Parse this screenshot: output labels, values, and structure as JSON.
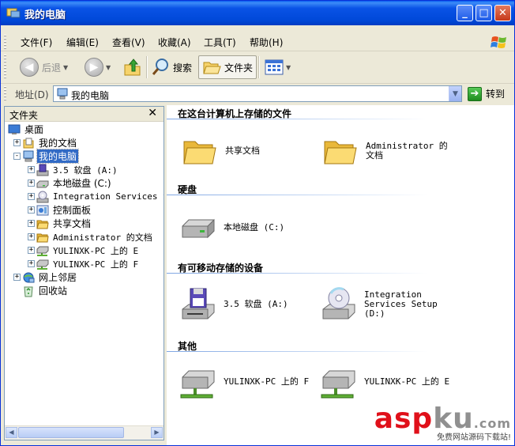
{
  "window": {
    "title": "我的电脑",
    "controls": [
      "_",
      "□",
      "✕"
    ]
  },
  "menubar": {
    "items": [
      "文件(F)",
      "编辑(E)",
      "查看(V)",
      "收藏(A)",
      "工具(T)",
      "帮助(H)"
    ]
  },
  "toolbar": {
    "back": "后退",
    "search": "搜索",
    "folders": "文件夹"
  },
  "address": {
    "label": "地址(D)",
    "value": "我的电脑",
    "go": "转到"
  },
  "folder_pane": {
    "title": "文件夹",
    "close": "✕",
    "tree": [
      {
        "label": "桌面",
        "level": 0,
        "expander": "",
        "icon": "desktop-icon"
      },
      {
        "label": "我的文档",
        "level": 1,
        "expander": "+",
        "icon": "my-documents-icon"
      },
      {
        "label": "我的电脑",
        "level": 1,
        "expander": "−",
        "icon": "my-computer-icon",
        "selected": true
      },
      {
        "label": "3.5 软盘 (A:)",
        "level": 2,
        "expander": "+",
        "icon": "floppy-icon"
      },
      {
        "label": "本地磁盘 (C:)",
        "level": 2,
        "expander": "+",
        "icon": "hard-disk-icon"
      },
      {
        "label": "Integration Services Se",
        "level": 2,
        "expander": "+",
        "icon": "cd-drive-icon"
      },
      {
        "label": "控制面板",
        "level": 2,
        "expander": "+",
        "icon": "control-panel-icon"
      },
      {
        "label": "共享文档",
        "level": 2,
        "expander": "+",
        "icon": "folder-icon"
      },
      {
        "label": "Administrator 的文档",
        "level": 2,
        "expander": "+",
        "icon": "folder-icon"
      },
      {
        "label": "YULINXK-PC 上的 E",
        "level": 2,
        "expander": "+",
        "icon": "network-drive-icon"
      },
      {
        "label": "YULINXK-PC 上的 F",
        "level": 2,
        "expander": "+",
        "icon": "network-drive-icon"
      },
      {
        "label": "网上邻居",
        "level": 1,
        "expander": "+",
        "icon": "network-places-icon"
      },
      {
        "label": "回收站",
        "level": 1,
        "expander": "",
        "icon": "recycle-bin-icon"
      }
    ]
  },
  "content": {
    "groups": [
      {
        "title": "在这台计算机上存储的文件",
        "items": [
          {
            "label": "共享文档",
            "icon": "folder-icon"
          },
          {
            "label": "Administrator 的文档",
            "icon": "folder-icon"
          }
        ]
      },
      {
        "title": "硬盘",
        "items": [
          {
            "label": "本地磁盘 (C:)",
            "icon": "hard-disk-icon"
          }
        ]
      },
      {
        "title": "有可移动存储的设备",
        "items": [
          {
            "label": "3.5 软盘 (A:)",
            "icon": "floppy-drive-icon"
          },
          {
            "label": "Integration Services Setup (D:)",
            "icon": "cd-drive-icon"
          }
        ]
      },
      {
        "title": "其他",
        "items": [
          {
            "label": "YULINXK-PC 上的 F",
            "icon": "network-drive-icon"
          },
          {
            "label": "YULINXK-PC 上的 E",
            "icon": "network-drive-icon"
          }
        ]
      }
    ]
  },
  "watermark": {
    "main_red": "asp",
    "main_gray": "ku",
    "domain": ".com",
    "sub": "免费网站源码下载站!"
  },
  "colors": {
    "titlebar": "#0A53E6",
    "selection": "#316AC5",
    "group_rule": "#7FA6E3",
    "chrome": "#ECE9D8"
  }
}
